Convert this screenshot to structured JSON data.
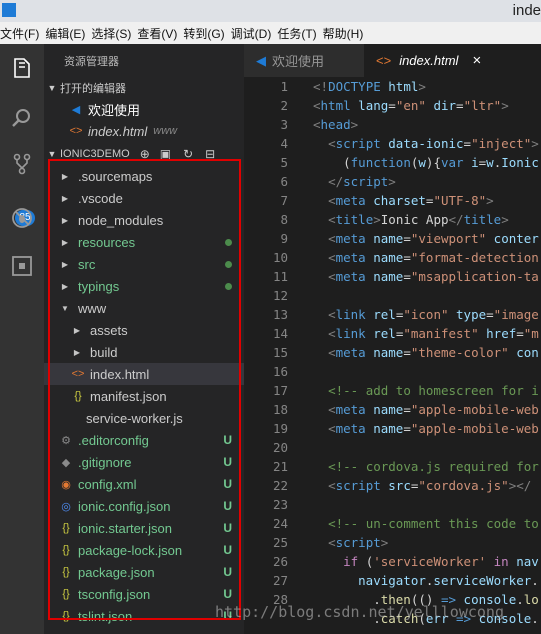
{
  "window": {
    "title": "inde"
  },
  "menu": [
    "文件(F)",
    "编辑(E)",
    "选择(S)",
    "查看(V)",
    "转到(G)",
    "调试(D)",
    "任务(T)",
    "帮助(H)"
  ],
  "activity": {
    "badge": "85"
  },
  "sidebar": {
    "title": "资源管理器",
    "open_editors_label": "打开的编辑器",
    "open_editors": [
      {
        "label": "欢迎使用",
        "extra": ""
      },
      {
        "label": "index.html",
        "extra": "www"
      }
    ],
    "project_label": "IONIC3DEMO",
    "tree": [
      {
        "label": ".sourcemaps",
        "marker": ""
      },
      {
        "label": ".vscode",
        "marker": ""
      },
      {
        "label": "node_modules",
        "marker": ""
      },
      {
        "label": "resources",
        "marker": ""
      },
      {
        "label": "src",
        "marker": ""
      },
      {
        "label": "typings",
        "marker": ""
      },
      {
        "label": "www",
        "marker": ""
      },
      {
        "label": "assets",
        "marker": ""
      },
      {
        "label": "build",
        "marker": ""
      },
      {
        "label": "index.html",
        "marker": ""
      },
      {
        "label": "manifest.json",
        "marker": ""
      },
      {
        "label": "service-worker.js",
        "marker": ""
      },
      {
        "label": ".editorconfig",
        "marker": "U"
      },
      {
        "label": ".gitignore",
        "marker": "U"
      },
      {
        "label": "config.xml",
        "marker": "U"
      },
      {
        "label": "ionic.config.json",
        "marker": "U"
      },
      {
        "label": "ionic.starter.json",
        "marker": "U"
      },
      {
        "label": "package-lock.json",
        "marker": "U"
      },
      {
        "label": "package.json",
        "marker": "U"
      },
      {
        "label": "tsconfig.json",
        "marker": "U"
      },
      {
        "label": "tslint.json",
        "marker": "U"
      }
    ]
  },
  "tabs": [
    {
      "label": "欢迎使用"
    },
    {
      "label": "index.html",
      "close": "×"
    }
  ],
  "editor": {
    "line_numbers": [
      "1",
      "2",
      "3",
      "4",
      "5",
      "6",
      "7",
      "8",
      "9",
      "10",
      "11",
      "12",
      "13",
      "14",
      "15",
      "16",
      "17",
      "18",
      "19",
      "20",
      "21",
      "22",
      "23",
      "24",
      "25",
      "26",
      "27",
      "28"
    ]
  },
  "watermark": "http://blog.csdn.net/yelllowcong"
}
